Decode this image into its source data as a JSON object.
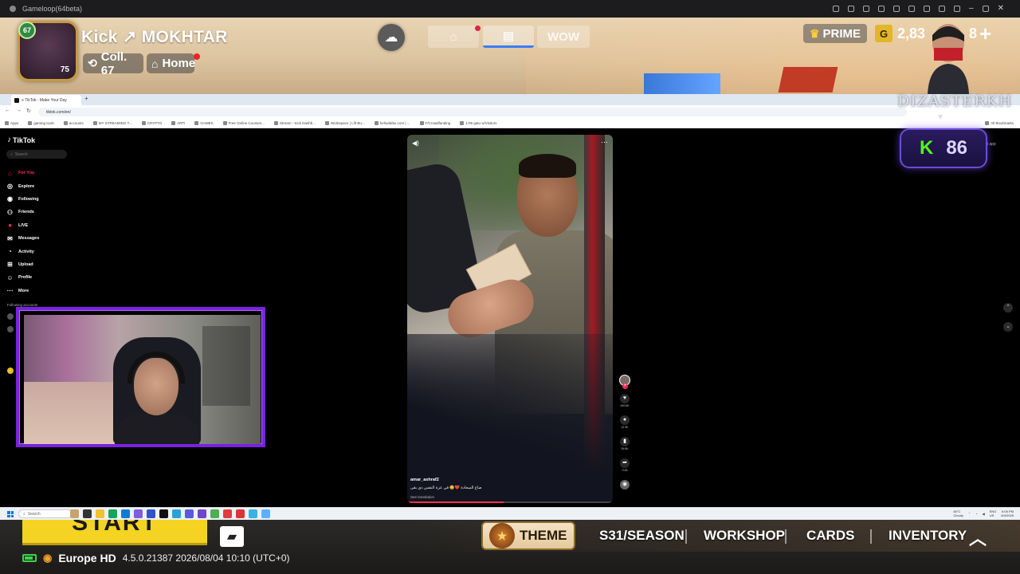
{
  "emulator": {
    "title": "Gameloop(64beta)"
  },
  "game_top": {
    "player": {
      "level": "67",
      "avatar_number": "75",
      "name": "Kick ↗ MOKHTAR"
    },
    "coll_label": "Coll. 67",
    "home_label": "Home",
    "mode_tab_3": "WOW",
    "prime_label": "PRIME",
    "currency_value": "2,83",
    "currency_suffix": "8"
  },
  "overlay": {
    "brand": "DIZASTERKH",
    "kick_count": "86"
  },
  "browser": {
    "tab_title": "≡ TikTok - Make Your Day",
    "url": "tiktok.com/en/",
    "bookmarks": [
      "Apps",
      "gaming tools",
      "accounts",
      "MY STREAMING T...",
      "CRYPTO",
      "ARTI",
      "GAMES",
      "Free Online Courses...",
      "Stream - Kick Dashb...",
      "Workspace | Lift Bu...",
      "forliodafax.com | ...",
      "F/Crowdfunding",
      "1:09 gatu w/Visitors"
    ],
    "all_bookmarks": "All Bookmarks"
  },
  "tiktok": {
    "logo": "TikTok",
    "search_placeholder": "Search",
    "nav": [
      {
        "label": "For You",
        "icon": "home-icon"
      },
      {
        "label": "Explore",
        "icon": "compass-icon"
      },
      {
        "label": "Following",
        "icon": "following-icon"
      },
      {
        "label": "Friends",
        "icon": "friends-icon"
      },
      {
        "label": "LIVE",
        "icon": "live-icon"
      },
      {
        "label": "Messages",
        "icon": "messages-icon"
      },
      {
        "label": "Activity",
        "icon": "activity-icon"
      },
      {
        "label": "Upload",
        "icon": "upload-icon"
      },
      {
        "label": "Profile",
        "icon": "profile-icon"
      },
      {
        "label": "More",
        "icon": "more-icon"
      }
    ],
    "following_accounts": "Following accounts",
    "video": {
      "username": "amar_ashraf2",
      "caption": "صاع السعادة ❤️😊 في عزة النفس دي بقى",
      "see_translation": "See translation",
      "progress": 0.47
    },
    "actions": {
      "likes": "440.6K",
      "comments": "12.3K",
      "saves": "39.5K",
      "shares": "7131"
    },
    "get_app": "Get app"
  },
  "taskbar": {
    "search_placeholder": "Search",
    "weather_temp": "80°C",
    "weather_desc": "Cloudy",
    "lang": "ENG",
    "region": "US",
    "time": "6:06 PM",
    "date": "8/4/2026"
  },
  "game_bottom": {
    "start_label": "START",
    "theme_label": "THEME",
    "season_label": "S31/SEASON",
    "workshop_label": "WORKSHOP",
    "cards_label": "CARDS",
    "inventory_label": "INVENTORY",
    "server_region": "Europe HD",
    "version": "4.5.0.21387 2026/08/04 10:10 (UTC+0)"
  },
  "colors": {
    "tiktok_red": "#fe2c55",
    "kick_green": "#53fc18",
    "start_yellow": "#f4d322",
    "cam_border": "#7a22e0"
  }
}
